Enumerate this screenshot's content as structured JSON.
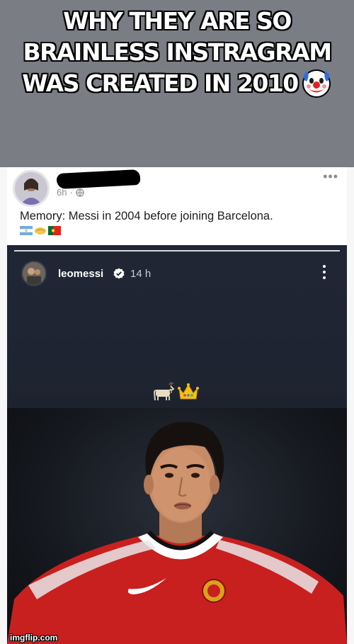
{
  "caption": {
    "line1": "WHY THEY ARE SO",
    "line2": "BRAINLESS INSTRAGRAM",
    "line3": "WAS CREATED IN 2010",
    "emoji_icon": "clown-face-icon",
    "background": "#7a7d83"
  },
  "post": {
    "time": "6h",
    "separator": "·",
    "text": "Memory: Messi in 2004 before joining Barcelona.",
    "flags": [
      "argentina-flag-icon",
      "handshake-icon",
      "portugal-flag-icon"
    ]
  },
  "instagram": {
    "username": "leomessi",
    "time": "14 h",
    "emojis": [
      "goat-icon",
      "crown-icon"
    ]
  },
  "watermark": "imgflip.com",
  "colors": {
    "caption_text": "#ffffff",
    "jersey_red": "#c8201f",
    "verified_blue": "#ffffff"
  }
}
